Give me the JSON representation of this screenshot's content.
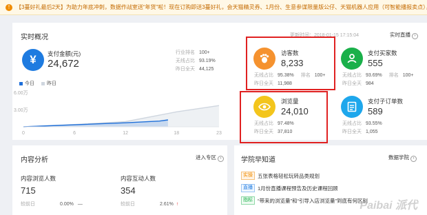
{
  "notice": {
    "text": "【3蔓好礼最后2天】为助力年底冲刺，数据作战室送“年货”啦！现在订购即送3蔓好礼，会天猫精灵券、1月份、生意参谋限量版公仔、天猫机器人应用（可智能播报卖点），最后2天3"
  },
  "overview": {
    "title": "实时概况",
    "update_label": "更新时间：",
    "update_time": "2018-01-15 17:15:04",
    "live_link": "实时直播",
    "pay": {
      "label": "支付金额(元)",
      "value": "24,672",
      "icon": "yen-icon",
      "rows": [
        {
          "k": "行业排名",
          "v": "100+"
        },
        {
          "k": "无线占比",
          "v": "93.19%"
        },
        {
          "k": "昨日全天",
          "v": "44,125"
        }
      ]
    },
    "visitors": {
      "label": "访客数",
      "value": "8,233",
      "icon": "footprint-icon",
      "share_k": "无线占比",
      "share_v": "95.38%",
      "rank_k": "排名",
      "rank_v": "100+",
      "yest_k": "昨日全天",
      "yest_v": "11,988"
    },
    "buyers": {
      "label": "支付买家数",
      "value": "555",
      "icon": "user-icon",
      "share_k": "无线占比",
      "share_v": "93.69%",
      "rank_k": "排名",
      "rank_v": "100+",
      "yest_k": "昨日全天",
      "yest_v": "984"
    },
    "pageviews": {
      "label": "浏览量",
      "value": "24,010",
      "icon": "eye-icon",
      "share_k": "无线占比",
      "share_v": "97.48%",
      "yest_k": "昨日全天",
      "yest_v": "37,810"
    },
    "orders": {
      "label": "支付子订单数",
      "value": "589",
      "icon": "document-icon",
      "share_k": "无线占比",
      "share_v": "93.55%",
      "yest_k": "昨日全天",
      "yest_v": "1,055"
    },
    "colors": {
      "today": "#1e6fd9",
      "yesterday": "#cfd6df"
    }
  },
  "chart_data": {
    "type": "area",
    "series": [
      {
        "name": "今日",
        "x": [
          0,
          6,
          12,
          16,
          17
        ],
        "values": [
          0,
          0.35,
          0.7,
          1.0,
          1.2
        ]
      },
      {
        "name": "昨日",
        "x": [
          0,
          6,
          12,
          18,
          23
        ],
        "values": [
          0,
          0.4,
          0.9,
          2.6,
          3.7
        ]
      }
    ],
    "x_ticks": [
      "0",
      "6",
      "12",
      "18",
      "23"
    ],
    "y_ticks": [
      "6.00万",
      "3.00万"
    ],
    "xlim": [
      0,
      23
    ],
    "ylim": [
      0,
      6
    ],
    "ylabel": "",
    "xlabel": "",
    "legend": "top-left",
    "grid": false
  },
  "content": {
    "title": "内容分析",
    "link": "进入专区",
    "browse": {
      "label": "内容浏览人数",
      "value": "715",
      "cmp": "较前日",
      "pct": "0.00%",
      "trend": "—"
    },
    "interact": {
      "label": "内容互动人数",
      "value": "354",
      "cmp": "较前日",
      "pct": "2.61%",
      "trend": "↑"
    }
  },
  "academy": {
    "title": "学院早知道",
    "link": "数据学院",
    "items": [
      {
        "tag": "实操",
        "text": "五张表格轻松玩转品类规划"
      },
      {
        "tag": "直播",
        "text": "1月份直播课程预告及历史课程回顾"
      },
      {
        "tag": "指标",
        "text": "“带来的浏览量”和“引导入店浏览量”到底有何区别"
      }
    ]
  },
  "watermark": "Paibai 派代"
}
